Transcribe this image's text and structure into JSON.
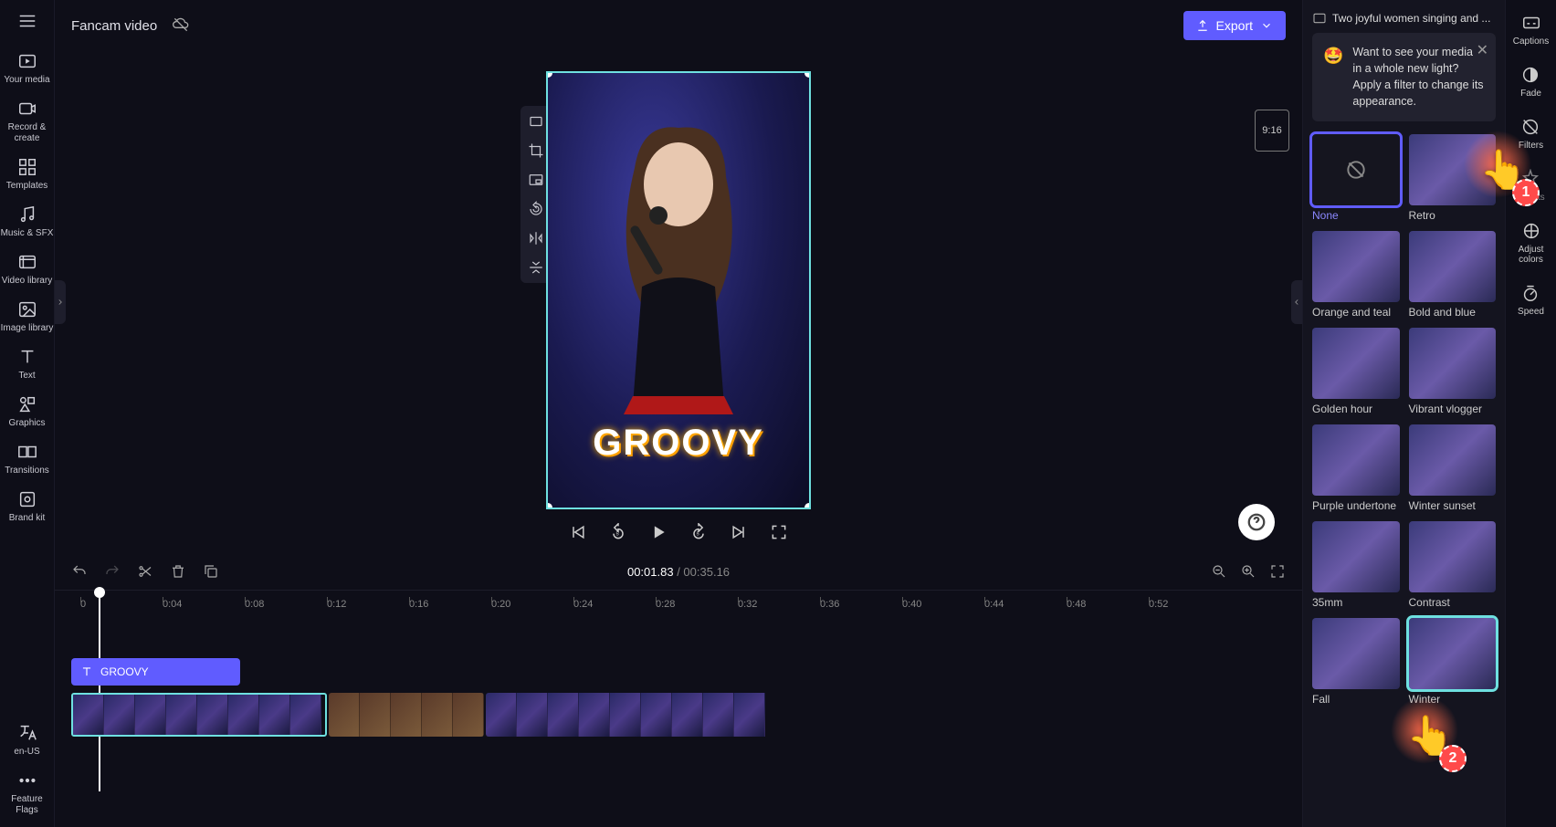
{
  "project": {
    "title": "Fancam video"
  },
  "export_label": "Export",
  "aspect_badge": "9:16",
  "overlay_text": "GROOVY",
  "time": {
    "current": "00:01.83",
    "total": "00:35.16"
  },
  "left_rail": [
    {
      "id": "your-media",
      "label": "Your media"
    },
    {
      "id": "record-create",
      "label": "Record & create"
    },
    {
      "id": "templates",
      "label": "Templates"
    },
    {
      "id": "music-sfx",
      "label": "Music & SFX"
    },
    {
      "id": "video-library",
      "label": "Video library"
    },
    {
      "id": "image-library",
      "label": "Image library"
    },
    {
      "id": "text",
      "label": "Text"
    },
    {
      "id": "graphics",
      "label": "Graphics"
    },
    {
      "id": "transitions",
      "label": "Transitions"
    },
    {
      "id": "brand-kit",
      "label": "Brand kit"
    }
  ],
  "left_rail_footer": [
    {
      "id": "lang",
      "label": "en-US"
    },
    {
      "id": "feature-flags",
      "label": "Feature Flags"
    }
  ],
  "prop_rail": [
    {
      "id": "captions",
      "label": "Captions"
    },
    {
      "id": "fade",
      "label": "Fade"
    },
    {
      "id": "filters",
      "label": "Filters"
    },
    {
      "id": "effects",
      "label": "Effects"
    },
    {
      "id": "adjust-colors",
      "label": "Adjust colors"
    },
    {
      "id": "speed",
      "label": "Speed"
    }
  ],
  "selected_clip_name": "Two joyful women singing and ...",
  "tip_text": "Want to see your media in a whole new light? Apply a filter to change its appearance.",
  "filters": [
    {
      "id": "none",
      "label": "None",
      "selected": true
    },
    {
      "id": "retro",
      "label": "Retro"
    },
    {
      "id": "orange-teal",
      "label": "Orange and teal"
    },
    {
      "id": "bold-blue",
      "label": "Bold and blue"
    },
    {
      "id": "golden-hour",
      "label": "Golden hour"
    },
    {
      "id": "vibrant-vlogger",
      "label": "Vibrant vlogger"
    },
    {
      "id": "purple-undertone",
      "label": "Purple undertone"
    },
    {
      "id": "winter-sunset",
      "label": "Winter sunset"
    },
    {
      "id": "35mm",
      "label": "35mm"
    },
    {
      "id": "contrast",
      "label": "Contrast"
    },
    {
      "id": "fall",
      "label": "Fall"
    },
    {
      "id": "winter",
      "label": "Winter",
      "highlighted": true
    }
  ],
  "ruler_ticks": [
    "0",
    "0:04",
    "0:08",
    "0:12",
    "0:16",
    "0:20",
    "0:24",
    "0:28",
    "0:32",
    "0:36",
    "0:40",
    "0:44",
    "0:48",
    "0:52"
  ],
  "text_track_label": "GROOVY",
  "pointer_badges": {
    "one": "1",
    "two": "2"
  },
  "colors": {
    "accent": "#605cff",
    "selection": "#6ee0e0"
  }
}
